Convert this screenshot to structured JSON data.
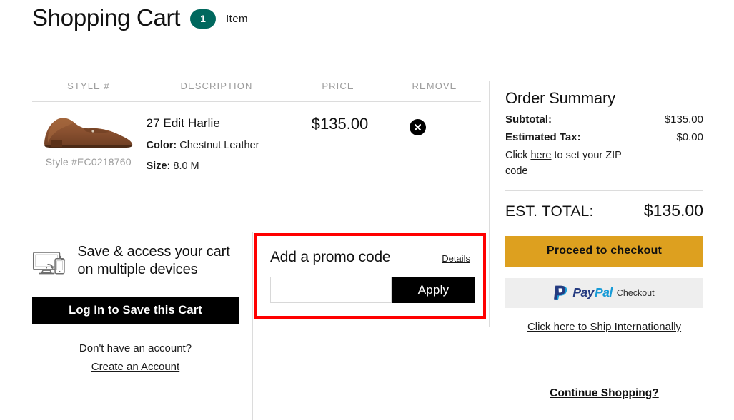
{
  "header": {
    "title": "Shopping Cart",
    "item_count": "1",
    "item_label": "Item",
    "badge_color": "#00685e"
  },
  "cart_table": {
    "columns": [
      "STYLE #",
      "DESCRIPTION",
      "PRICE",
      "REMOVE"
    ],
    "rows": [
      {
        "style_number": "Style #EC0218760",
        "product_name": "27 Edit Harlie",
        "color_label": "Color:",
        "color_value": "Chestnut Leather",
        "size_label": "Size:",
        "size_value": "8.0 M",
        "price": "$135.00",
        "remove_icon": "close-circle-icon"
      }
    ]
  },
  "save_cart": {
    "icon": "devices-sync-icon",
    "headline": "Save & access your cart on multiple devices",
    "login_button": "Log In to Save this Cart",
    "no_account_text": "Don't have an account?",
    "create_account_link": "Create an Account"
  },
  "promo": {
    "title": "Add a promo code",
    "details_link": "Details",
    "input_value": "",
    "input_placeholder": "",
    "apply_button": "Apply",
    "highlight_color": "#ff0000"
  },
  "order_summary": {
    "title": "Order Summary",
    "subtotal_label": "Subtotal:",
    "subtotal_value": "$135.00",
    "tax_label": "Estimated Tax:",
    "tax_value": "$0.00",
    "zip_note_prefix": "Click ",
    "zip_note_link": "here",
    "zip_note_suffix": " to set your ZIP code",
    "total_label": "EST. TOTAL:",
    "total_value": "$135.00",
    "checkout_button": "Proceed to checkout",
    "checkout_button_color": "#dda01f",
    "paypal_pay_text": "Pay",
    "paypal_pal_text": "Pal",
    "paypal_checkout_word": "Checkout",
    "paypal_dark_color": "#253b80",
    "paypal_light_color": "#179bd7",
    "ship_international_link": "Click here to Ship Internationally",
    "continue_shopping_link": "Continue Shopping?"
  }
}
